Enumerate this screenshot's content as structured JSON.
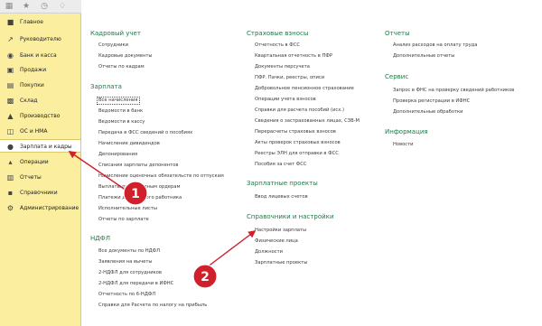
{
  "toolbar": {
    "icons": [
      "grid-icon",
      "star-icon",
      "history-icon",
      "bell-icon"
    ]
  },
  "sidebar": {
    "items": [
      {
        "label": "Главное",
        "icon": "home-icon"
      },
      {
        "label": "Руководителю",
        "icon": "chart-icon"
      },
      {
        "label": "Банк и касса",
        "icon": "bank-icon"
      },
      {
        "label": "Продажи",
        "icon": "sales-icon"
      },
      {
        "label": "Покупки",
        "icon": "cart-icon"
      },
      {
        "label": "Склад",
        "icon": "warehouse-icon"
      },
      {
        "label": "Производство",
        "icon": "factory-icon"
      },
      {
        "label": "ОС и НМА",
        "icon": "assets-icon"
      },
      {
        "label": "Зарплата и кадры",
        "icon": "person-icon"
      },
      {
        "label": "Операции",
        "icon": "operations-icon"
      },
      {
        "label": "Отчеты",
        "icon": "reports-icon"
      },
      {
        "label": "Справочники",
        "icon": "book-icon"
      },
      {
        "label": "Администрирование",
        "icon": "gear-icon"
      }
    ],
    "active_index": 8
  },
  "sections": {
    "kadr": {
      "title": "Кадровый учет",
      "links": [
        "Сотрудники",
        "Кадровые документы",
        "Отчеты по кадрам"
      ]
    },
    "zarplata": {
      "title": "Зарплата",
      "links": [
        "Все начисления",
        "Ведомости в банк",
        "Ведомости в кассу",
        "Передача в ФСС сведений о пособиях",
        "Начисление дивидендов",
        "Депонирования",
        "Списания зарплаты депонентов",
        "Начисление оценочных обязательств по отпускам",
        "Выплаты по расходным ордерам",
        "Платежи для каждого работника",
        "Исполнительные листы",
        "Отчеты по зарплате"
      ]
    },
    "ndfl": {
      "title": "НДФЛ",
      "links": [
        "Все документы по НДФЛ",
        "Заявления на вычеты",
        "2-НДФЛ для сотрудников",
        "2-НДФЛ для передачи в ИФНС",
        "Отчетность по 6-НДФЛ",
        "Справки для Расчета по налогу на прибыль"
      ]
    },
    "strah": {
      "title": "Страховые взносы",
      "links": [
        "Отчетность в ФСС",
        "Квартальная отчетность в ПФР",
        "Документы персучета",
        "ПФР. Пачки, реестры, описи",
        "Добровольное пенсионное страхование",
        "Операции учета взносов",
        "Справки для расчета пособий (исх.)",
        "Сведения о застрахованных лицах, СЗВ-М",
        "Перерасчеты страховых взносов",
        "Акты проверок страховых взносов",
        "Реестры ЭЛН для отправки в ФСС",
        "Пособия за счет ФСС"
      ]
    },
    "proekty": {
      "title": "Зарплатные проекты",
      "links": [
        "Ввод лицевых счетов"
      ]
    },
    "sprav": {
      "title": "Справочники и настройки",
      "links": [
        "Настройки зарплаты",
        "Физические лица",
        "Должности",
        "Зарплатные проекты"
      ]
    },
    "otchety": {
      "title": "Отчеты",
      "links": [
        "Анализ расходов на оплату труда",
        "Дополнительные отчеты"
      ]
    },
    "servis": {
      "title": "Сервис",
      "links": [
        "Запрос в ФНС на проверку сведений работников",
        "Проверка регистрации в ИФНС",
        "Дополнительные обработки"
      ]
    },
    "info": {
      "title": "Информация",
      "links": [
        "Новости"
      ]
    }
  },
  "annotations": {
    "badge_1": "1",
    "badge_2": "2",
    "color": "#d0202c"
  },
  "colors": {
    "sidebar_bg": "#fbee9f",
    "section_title": "#1d7a45",
    "link_text": "#3a3a3a"
  }
}
